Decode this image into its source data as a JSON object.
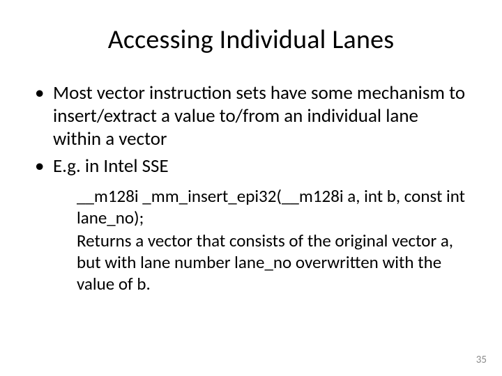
{
  "title": "Accessing Individual Lanes",
  "bullets": [
    "Most vector instruction sets have some mechanism to insert/extract a value to/from an individual lane within a vector",
    "E.g. in Intel SSE"
  ],
  "sub": {
    "line1": "__m128i _mm_insert_epi32(__m128i a, int b, const int lane_no);",
    "line2": "Returns a vector that consists of the original vector a, but with lane number lane_no overwritten with the value of b."
  },
  "pagenum": "35"
}
